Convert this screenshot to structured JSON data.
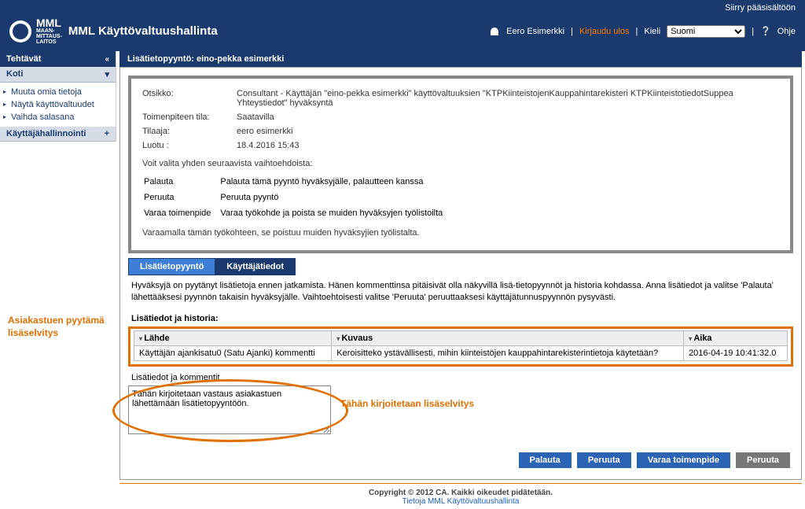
{
  "header": {
    "skip_link": "Siirry pääsisältöön",
    "logo_mml": "MML",
    "logo_sub": "MAAN-\nMITTAUS-\nLAITOS",
    "title": "MML Käyttövaltuushallinta",
    "user_name": "Eero Esimerkki",
    "logout": "Kirjaudu ulos",
    "lang_label": "Kieli",
    "lang_value": "Suomi",
    "help": "Ohje"
  },
  "sidebar": {
    "header": "Tehtävät",
    "collapse": "«",
    "sec_home": "Koti",
    "items": [
      "Muuta omia tietoja",
      "Näytä käyttövaltuudet",
      "Vaihda salasana"
    ],
    "sec_admin": "Käyttäjähallinnointi",
    "plus": "+"
  },
  "main": {
    "panel_title": "Lisätietopyyntö: eino-pekka esimerkki",
    "info": {
      "otsikko_label": "Otsikko:",
      "otsikko": "Consultant - Käyttäjän \"eino-pekka esimerkki\" käyttövaltuuksien \"KTPKiinteistojenKauppahintarekisteri KTPKiinteistotiedotSuppea Yhteystiedot\" hyväksyntä",
      "tila_label": "Toimenpiteen tila:",
      "tila": "Saatavilla",
      "tilaaja_label": "Tilaaja:",
      "tilaaja": "eero esimerkki",
      "luotu_label": "Luotu :",
      "luotu": "18.4.2016 15:43",
      "choice_intro": "Voit valita yhden seuraavista vaihtoehdoista:",
      "opts": [
        {
          "name": "Palauta",
          "desc": "Palauta tämä pyyntö hyväksyjälle, palautteen kanssa"
        },
        {
          "name": "Peruuta",
          "desc": "Peruuta pyyntö"
        },
        {
          "name": "Varaa toimenpide",
          "desc": "Varaa työkohde ja poista se muiden hyväksyjen työlistoilta"
        }
      ],
      "footer": "Varaamalla tämän työkohteen, se poistuu muiden hyväksyjien työlistalta."
    },
    "tabs": {
      "active": "Lisätietopyyntö",
      "inactive": "Käyttäjätiedot"
    },
    "explain": "Hyväksyjä on pyytänyt lisätietoja ennen jatkamista. Hänen kommenttinsa pitäisivät olla näkyvillä lisä-tietopyynnöt ja historia kohdassa. Anna lisätiedot ja valitse 'Palauta' lähettääksesi pyynnön takaisin hyväksyjälle. Vaihtoehtoisesti valitse 'Peruuta' peruuttaaksesi käyttäjätunnuspyynnön pysyvästi.",
    "history_label": "Lisätiedot ja historia:",
    "grid": {
      "col_lahde": "Lähde",
      "col_kuvaus": "Kuvaus",
      "col_aika": "Aika",
      "rows": [
        {
          "lahde": "Käyttäjän ajankisatu0 (Satu Ajanki) kommentti",
          "kuvaus": "Keroisitteko ystävällisesti, mihin kiinteistöjen kauppahintarekisterintietoja käytetään?",
          "aika": "2016-04-19 10:41:32.0"
        }
      ]
    },
    "comments_label": "Lisätiedot ja kommentit",
    "comments_value": "Tähän kirjoitetaan vastaus asiakastuen lähettämään lisätietopyyntöön.",
    "callout_left": "Asiakastuen pyytämä lisäselvitys",
    "callout_side": "Tähän kirjoitetaan lisäselvitys",
    "actions": {
      "palauta": "Palauta",
      "peruuta": "Peruuta",
      "varaa": "Varaa toimenpide",
      "peruuta2": "Peruuta"
    }
  },
  "footer": {
    "copy": "Copyright © 2012 CA. Kaikki oikeudet pidätetään.",
    "link": "Tietoja MML Käyttövaltuushallinta"
  }
}
